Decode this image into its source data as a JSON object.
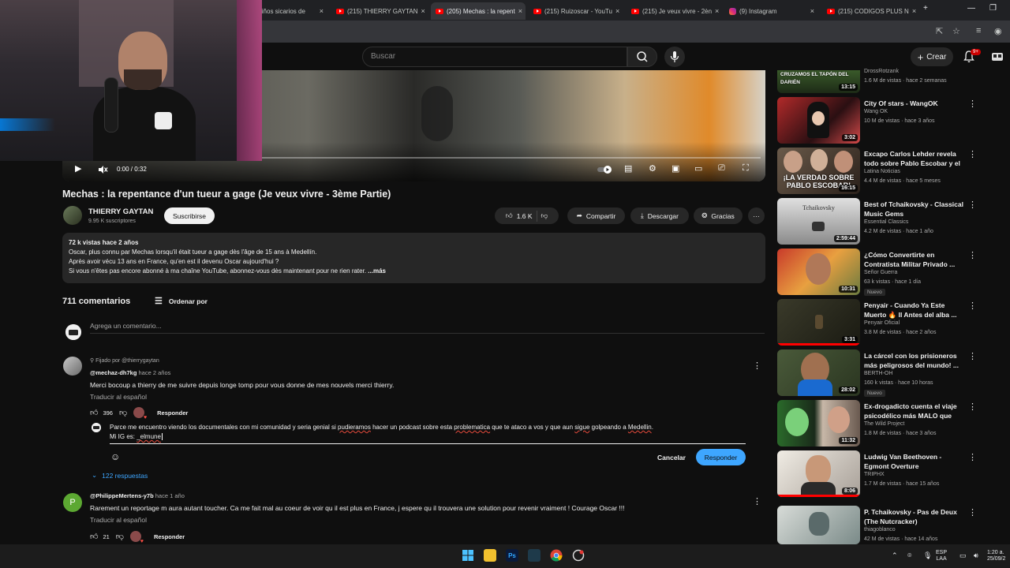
{
  "browser": {
    "tabs": [
      {
        "label": "Niños sicarios de",
        "icon": "youtube-icon",
        "active": false
      },
      {
        "label": "(215) THIERRY GAYTAN",
        "icon": "youtube-icon",
        "active": false
      },
      {
        "label": "(205) Mechas : la repent",
        "icon": "youtube-icon",
        "active": true
      },
      {
        "label": "(215) Ruizoscar - YouTu",
        "icon": "youtube-icon",
        "active": false
      },
      {
        "label": "(215) Je veux vivre - 2èn",
        "icon": "youtube-icon",
        "active": false
      },
      {
        "label": "(9) Instagram",
        "icon": "instagram-icon",
        "active": false
      },
      {
        "label": "(215) CODIGOS PLUS N",
        "icon": "youtube-icon",
        "active": false
      }
    ],
    "new_tab": "+",
    "close_glyph": "×"
  },
  "header": {
    "search_placeholder": "Buscar",
    "create_label": "Crear",
    "notifications_badge": "9+"
  },
  "player": {
    "time": "0:00 / 0:32"
  },
  "video": {
    "title": "Mechas : la repentance d'un tueur a gage (Je veux vivre - 3ème Partie)",
    "channel_name": "THIERRY GAYTAN",
    "channel_subs": "9.95 K suscriptores",
    "subscribe_label": "Suscribirse",
    "likes": "1.6 K",
    "share_label": "Compartir",
    "download_label": "Descargar",
    "thanks_label": "Gracias",
    "more": "···"
  },
  "description": {
    "stats": "72 k vistas  hace 2 años",
    "line1": "Oscar, plus connu par Mechas lorsqu'il était tueur a gage dès l'âge de 15 ans à Medellín.",
    "line2": "Après avoir vécu 13 ans en France, qu'en est il devenu Oscar aujourd'hui  ?",
    "line3": "Si vous n'êtes pas encore abonné à ma chaîne YouTube, abonnez-vous dès maintenant pour ne rien rater.",
    "more": "...más"
  },
  "comments": {
    "count": "711 comentarios",
    "sort_label": "Ordenar por",
    "add_placeholder": "Agrega un comentario...",
    "items": [
      {
        "pinned": "Fijado por @thierrygaytan",
        "author": "@mechaz-dh7kg",
        "ago": "hace 2 años",
        "text": "Merci bocoup  a thierry  de me suivre  depuis  longe  tomp  pour  vous  donne  de mes  nouvels merci  thierry.",
        "translate": "Traducir al español",
        "likes": "396",
        "reply": "Responder",
        "replies_toggle": "122 respuestas"
      },
      {
        "author": "@PhilippeMertens-y7b",
        "ago": "hace 1 año",
        "avatar_letter": "P",
        "text": "Rarement un reportage m aura autant toucher.  Ca me fait mal au coeur de voir qu il est plus en France, j espere qu il trouvera une solution pour revenir vraiment ! Courage Oscar !!!",
        "translate": "Traducir al español",
        "likes": "21",
        "reply": "Responder"
      }
    ]
  },
  "reply_draft": {
    "p1": "Parce me encuentro viendo los documentales con mi comunidad y seria genial si ",
    "w1": "pudieramos",
    "p2": " hacer un podcast sobre esta ",
    "w2": "problematica",
    "p3": " que te ataco a vos y que aun ",
    "w3": "sigue",
    "p4": " golpeando a ",
    "w4": "Medellin",
    "p5": ".",
    "line2": "Mi IG es: ",
    "handle": "_elmune",
    "cancel": "Cancelar",
    "submit": "Responder"
  },
  "sidebar": [
    {
      "thumb_text": "CRUZAMOS EL TAPÓN DEL DARIÉN",
      "duration": "13:15",
      "title": "",
      "channel": "DrossRotzank",
      "meta": "1.6 M de vistas · hace 2 semanas",
      "new": ""
    },
    {
      "thumb_text": "",
      "duration": "3:02",
      "title": "City Of stars - WangOK",
      "channel": "Wang OK",
      "meta": "10 M de vistas · hace 3 años",
      "new": ""
    },
    {
      "thumb_text": "¡LA VERDAD SOBRE PABLO ESCOBAR!",
      "duration": "16:15",
      "title": "Excapo Carlos Lehder revela todo sobre Pablo Escobar y el ...",
      "channel": "Latina Noticias",
      "meta": "4.4 M de vistas · hace 5 meses",
      "new": ""
    },
    {
      "thumb_text": "Tchaikovsky",
      "duration": "2:59:44",
      "title": "Best of Tchaikovsky - Classical Music Gems",
      "channel": "Essential Classics",
      "meta": "4.2 M de vistas · hace 1 año",
      "new": ""
    },
    {
      "thumb_text": "",
      "duration": "10:31",
      "title": "¿Cómo Convertirte en Contratista Militar Privado ...",
      "channel": "Señor Guerra",
      "meta": "63 k vistas · hace 1 día",
      "new": "Nuevo"
    },
    {
      "thumb_text": "",
      "duration": "3:31",
      "title": "Penyair - Cuando Ya Este Muerto 🔥 Il Antes del alba ...",
      "channel": "Penyair Oficial",
      "meta": "3.8 M de vistas · hace 2 años",
      "new": ""
    },
    {
      "thumb_text": "",
      "duration": "28:02",
      "title": "La cárcel con los prisioneros más peligrosos del mundo! ...",
      "channel": "BERTH-OH",
      "meta": "160 k vistas · hace 10 horas",
      "new": "Nuevo"
    },
    {
      "thumb_text": "",
      "duration": "11:32",
      "title": "Ex-drogadicto cuenta el viaje psicodélico más MALO que ha...",
      "channel": "The Wild Project",
      "meta": "1.8 M de vistas · hace 3 años",
      "new": ""
    },
    {
      "thumb_text": "",
      "duration": "8:06",
      "title": "Ludwig Van Beethoven - Egmont Overture",
      "channel": "TRIPHX",
      "meta": "1.7 M de vistas · hace 15 años",
      "new": ""
    },
    {
      "thumb_text": "",
      "duration": "",
      "title": "P. Tchaikovsky - Pas de Deux (The Nutcracker)",
      "channel": "thiagoblanco",
      "meta": "42 M de vistas · hace 14 años",
      "new": ""
    }
  ],
  "taskbar": {
    "lang1": "ESP",
    "lang2": "LAA",
    "time": "1:20 a.",
    "date": "25/09/2"
  },
  "colors": {
    "accent_blue": "#3ea6ff",
    "youtube_red": "#ff0000",
    "bg": "#0f0f0f"
  }
}
